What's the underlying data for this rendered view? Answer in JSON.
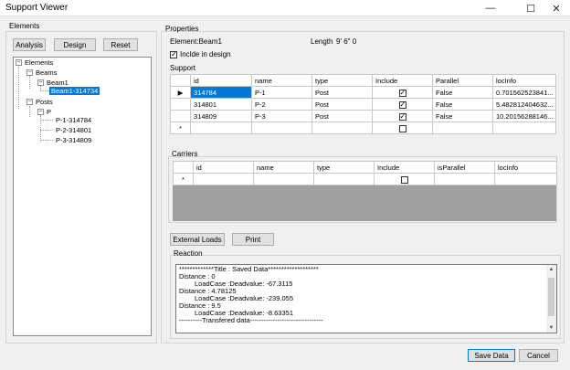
{
  "window": {
    "title": "Support Viewer",
    "minimize_glyph": "—",
    "maximize_glyph": "☐",
    "close_glyph": "✕"
  },
  "elements_panel": {
    "label": "Elements",
    "buttons": {
      "analysis": "Analysis",
      "design": "Design",
      "reset": "Reset"
    },
    "tree": {
      "root": "Elements",
      "beams": "Beams",
      "beam1": "Beam1",
      "beam1_child": "Beam1-314734",
      "posts": "Posts",
      "p": "P",
      "p_children": [
        "P-1-314784",
        "P-2-314801",
        "P-3-314809"
      ]
    }
  },
  "properties": {
    "label": "Properties",
    "element_text": "Element:Beam1",
    "length_label": "Length",
    "length_value": "9' 6\" 0",
    "include_design_label": "Inclde in design",
    "include_design_checked": true
  },
  "support": {
    "label": "Support",
    "columns": [
      "id",
      "name",
      "type",
      "Include",
      "Parallel",
      "locInfo"
    ],
    "rows": [
      {
        "id": "314784",
        "name": "P-1",
        "type": "Post",
        "include": true,
        "parallel": "False",
        "locinfo": "0.701562523841..."
      },
      {
        "id": "314801",
        "name": "P-2",
        "type": "Post",
        "include": true,
        "parallel": "False",
        "locinfo": "5.482812404632..."
      },
      {
        "id": "314809",
        "name": "P-3",
        "type": "Post",
        "include": true,
        "parallel": "False",
        "locinfo": "10.20156288146..."
      }
    ],
    "current_row_glyph": "▶",
    "new_row_glyph": "*"
  },
  "carriers": {
    "label": "Carriers",
    "columns": [
      "id",
      "name",
      "type",
      "Include",
      "isParallel",
      "locInfo"
    ],
    "new_row_glyph": "*"
  },
  "actions": {
    "external_loads": "External Loads",
    "print": "Print"
  },
  "reaction": {
    "label": "Reaction",
    "lines": [
      "*************Title : Saved Data*******************",
      "Distance : 0",
      "LoadCase :Deadvalue: -67.3115",
      "Distance : 4.78125",
      "LoadCase :Deadvalue: -239.055",
      "Distance : 9.5",
      "LoadCase :Deadvalue: -8.63351",
      "----------Transfered data--------------------------------"
    ]
  },
  "footer": {
    "save": "Save Data",
    "cancel": "Cancel"
  },
  "glyphs": {
    "check": "✓",
    "minus": "−",
    "scroll_up": "▲",
    "scroll_down": "▼"
  }
}
